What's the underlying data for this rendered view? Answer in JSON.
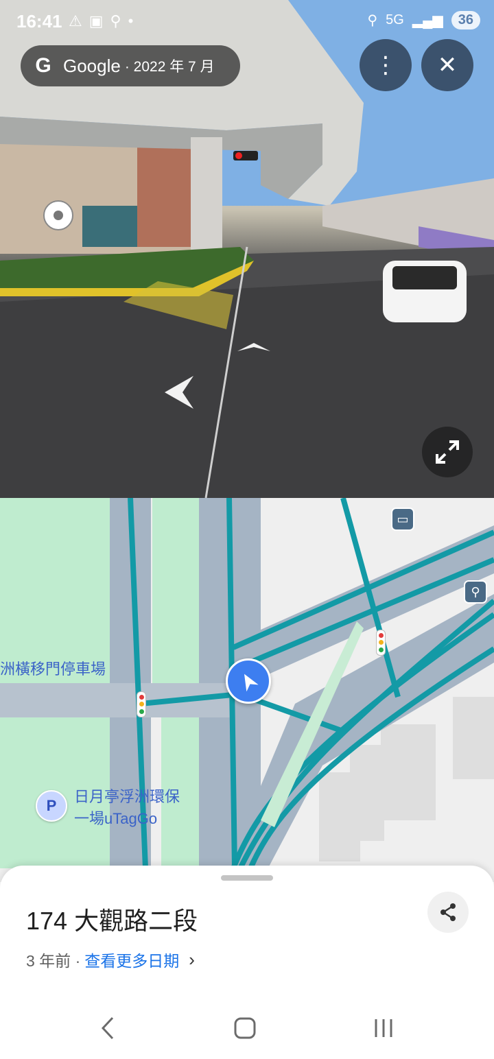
{
  "status_bar": {
    "time": "16:41",
    "network": "5G",
    "battery": "36"
  },
  "viewer": {
    "brand": "Google",
    "capture_date": "· 2022 年 7 月"
  },
  "map": {
    "labels": {
      "parking_lot": "洲橫移門停車場",
      "poi_line1": "日月亭浮洲環保",
      "poi_line2": "一場uTagGo"
    },
    "parking_glyph": "P"
  },
  "sheet": {
    "address": "174 大觀路二段",
    "age": "3 年前 ·",
    "more_dates_link": "查看更多日期",
    "chevron": "›"
  },
  "icons": {
    "more": "⋮",
    "close": "✕",
    "google_g": "G"
  }
}
